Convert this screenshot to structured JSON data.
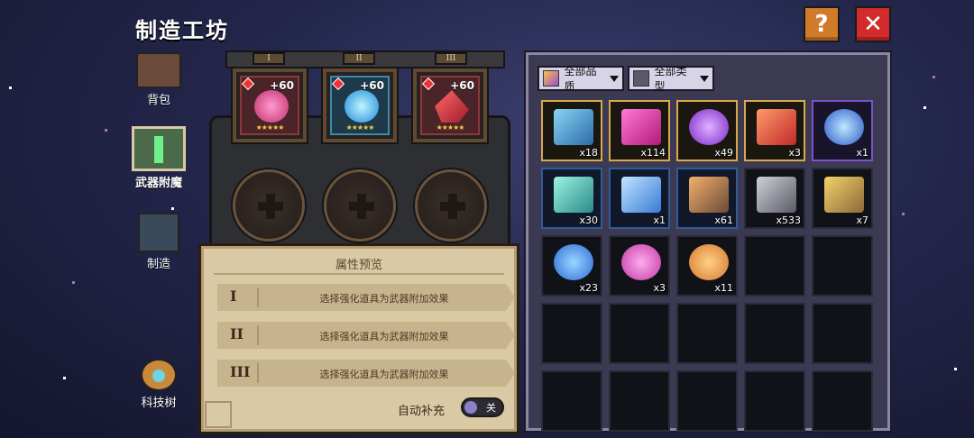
{
  "header": {
    "title": "制造工坊",
    "help_label": "?",
    "close_label": "✕"
  },
  "colors": {
    "accent": "#d07a2a",
    "close": "#d22b2b",
    "gold_border": "#d9a84a",
    "purple_border": "#7a52c8",
    "blue_border": "#2f5c9a"
  },
  "nav": {
    "items": [
      {
        "label": "背包",
        "icon": "chest-icon",
        "active": false
      },
      {
        "label": "武器附魔",
        "icon": "anvil-icon",
        "active": true
      },
      {
        "label": "制造",
        "icon": "craft-arm-icon",
        "active": false
      },
      {
        "label": "科技树",
        "icon": "tech-tree-icon",
        "active": false
      }
    ]
  },
  "forge": {
    "tabs": [
      "I",
      "II",
      "III"
    ],
    "slots": [
      {
        "bonus": "+60",
        "icon": "red-pink-gem-icon",
        "stars": "★★★★★"
      },
      {
        "bonus": "+60",
        "icon": "blue-orb-icon",
        "stars": "★★★★★"
      },
      {
        "bonus": "+60",
        "icon": "red-crystal-icon",
        "stars": "★★★★★"
      }
    ]
  },
  "preview": {
    "title": "属性预览",
    "rows": [
      {
        "num": "I",
        "text": "选择强化道具为武器附加效果"
      },
      {
        "num": "II",
        "text": "选择强化道具为武器附加效果"
      },
      {
        "num": "III",
        "text": "选择强化道具为武器附加效果"
      }
    ],
    "auto_label": "自动补充",
    "toggle_label": "关"
  },
  "inventory": {
    "filters": [
      {
        "label": "全部品质",
        "icon": "quality-gem-icon"
      },
      {
        "label": "全部类型",
        "icon": "type-chest-icon"
      }
    ],
    "rows": [
      [
        {
          "qty": "x18",
          "icon": "blue-ingot-icon",
          "tier": "gold"
        },
        {
          "qty": "x114",
          "icon": "pink-ingot-icon",
          "tier": "gold"
        },
        {
          "qty": "x49",
          "icon": "purple-rune-icon",
          "tier": "gold"
        },
        {
          "qty": "x3",
          "icon": "red-ingot-icon",
          "tier": "gold"
        },
        {
          "qty": "x1",
          "icon": "blue-rune-icon",
          "tier": "purple"
        }
      ],
      [
        {
          "qty": "x30",
          "icon": "teal-ore-icon",
          "tier": "blue"
        },
        {
          "qty": "x1",
          "icon": "blue-crystal-icon",
          "tier": "blue"
        },
        {
          "qty": "x61",
          "icon": "bronze-ore-icon",
          "tier": "blue"
        },
        {
          "qty": "x533",
          "icon": "gray-ore-icon",
          "tier": "none"
        },
        {
          "qty": "x7",
          "icon": "gold-ore-icon",
          "tier": "none"
        }
      ],
      [
        {
          "qty": "x23",
          "icon": "blue-potion-icon",
          "tier": "none"
        },
        {
          "qty": "x3",
          "icon": "pink-potion-icon",
          "tier": "none"
        },
        {
          "qty": "x11",
          "icon": "orange-potion-icon",
          "tier": "none"
        },
        {
          "qty": "",
          "icon": "",
          "tier": "empty"
        },
        {
          "qty": "",
          "icon": "",
          "tier": "empty"
        }
      ],
      [
        {
          "qty": "",
          "icon": "",
          "tier": "empty"
        },
        {
          "qty": "",
          "icon": "",
          "tier": "empty"
        },
        {
          "qty": "",
          "icon": "",
          "tier": "empty"
        },
        {
          "qty": "",
          "icon": "",
          "tier": "empty"
        },
        {
          "qty": "",
          "icon": "",
          "tier": "empty"
        }
      ],
      [
        {
          "qty": "",
          "icon": "",
          "tier": "empty"
        },
        {
          "qty": "",
          "icon": "",
          "tier": "empty"
        },
        {
          "qty": "",
          "icon": "",
          "tier": "empty"
        },
        {
          "qty": "",
          "icon": "",
          "tier": "empty"
        },
        {
          "qty": "",
          "icon": "",
          "tier": "empty"
        }
      ]
    ]
  }
}
